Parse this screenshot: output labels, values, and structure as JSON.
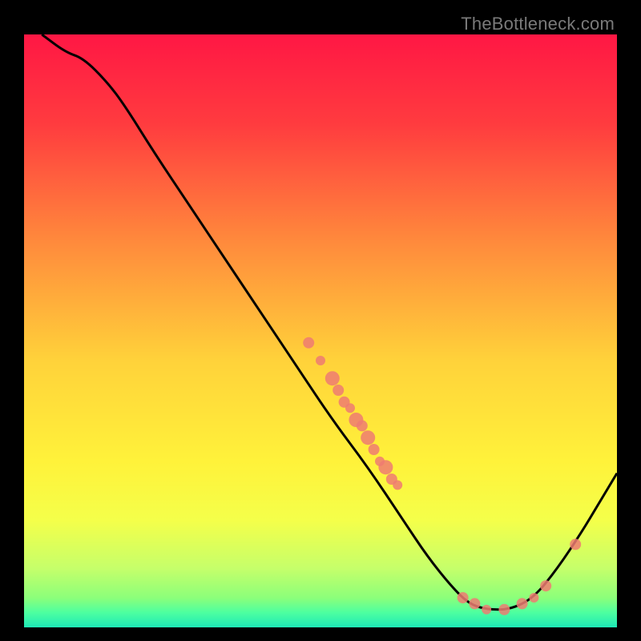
{
  "watermark": "TheBottleneck.com",
  "chart_data": {
    "type": "line",
    "title": "",
    "xlabel": "",
    "ylabel": "",
    "xlim": [
      0,
      100
    ],
    "ylim": [
      0,
      100
    ],
    "gradient_stops": [
      {
        "pos": 0.0,
        "color": "#ff1744"
      },
      {
        "pos": 0.15,
        "color": "#ff3b3f"
      },
      {
        "pos": 0.35,
        "color": "#ff8a3c"
      },
      {
        "pos": 0.55,
        "color": "#ffd23a"
      },
      {
        "pos": 0.72,
        "color": "#fff23a"
      },
      {
        "pos": 0.82,
        "color": "#f4ff4a"
      },
      {
        "pos": 0.9,
        "color": "#c6ff6a"
      },
      {
        "pos": 0.95,
        "color": "#8cff7a"
      },
      {
        "pos": 0.975,
        "color": "#4dffa0"
      },
      {
        "pos": 1.0,
        "color": "#1de9b6"
      }
    ],
    "curve": [
      {
        "x": 3,
        "y": 100
      },
      {
        "x": 7,
        "y": 97
      },
      {
        "x": 10,
        "y": 96
      },
      {
        "x": 14,
        "y": 92
      },
      {
        "x": 17,
        "y": 88
      },
      {
        "x": 22,
        "y": 80
      },
      {
        "x": 28,
        "y": 71
      },
      {
        "x": 34,
        "y": 62
      },
      {
        "x": 40,
        "y": 53
      },
      {
        "x": 46,
        "y": 44
      },
      {
        "x": 52,
        "y": 35
      },
      {
        "x": 58,
        "y": 27
      },
      {
        "x": 64,
        "y": 18
      },
      {
        "x": 68,
        "y": 12
      },
      {
        "x": 72,
        "y": 7
      },
      {
        "x": 75,
        "y": 4
      },
      {
        "x": 78,
        "y": 3
      },
      {
        "x": 82,
        "y": 3
      },
      {
        "x": 86,
        "y": 5
      },
      {
        "x": 90,
        "y": 10
      },
      {
        "x": 94,
        "y": 16
      },
      {
        "x": 97,
        "y": 21
      },
      {
        "x": 100,
        "y": 26
      }
    ],
    "scatter_clusters": [
      {
        "x": 48,
        "y": 48,
        "r": 7
      },
      {
        "x": 50,
        "y": 45,
        "r": 6
      },
      {
        "x": 52,
        "y": 42,
        "r": 9
      },
      {
        "x": 53,
        "y": 40,
        "r": 7
      },
      {
        "x": 54,
        "y": 38,
        "r": 7
      },
      {
        "x": 55,
        "y": 37,
        "r": 6
      },
      {
        "x": 56,
        "y": 35,
        "r": 9
      },
      {
        "x": 57,
        "y": 34,
        "r": 7
      },
      {
        "x": 58,
        "y": 32,
        "r": 9
      },
      {
        "x": 59,
        "y": 30,
        "r": 7
      },
      {
        "x": 60,
        "y": 28,
        "r": 6
      },
      {
        "x": 61,
        "y": 27,
        "r": 9
      },
      {
        "x": 62,
        "y": 25,
        "r": 7
      },
      {
        "x": 63,
        "y": 24,
        "r": 6
      },
      {
        "x": 74,
        "y": 5,
        "r": 7
      },
      {
        "x": 76,
        "y": 4,
        "r": 7
      },
      {
        "x": 78,
        "y": 3,
        "r": 6
      },
      {
        "x": 81,
        "y": 3,
        "r": 7
      },
      {
        "x": 84,
        "y": 4,
        "r": 7
      },
      {
        "x": 86,
        "y": 5,
        "r": 6
      },
      {
        "x": 88,
        "y": 7,
        "r": 7
      },
      {
        "x": 93,
        "y": 14,
        "r": 7
      }
    ],
    "scatter_color": "#ef7b72"
  }
}
